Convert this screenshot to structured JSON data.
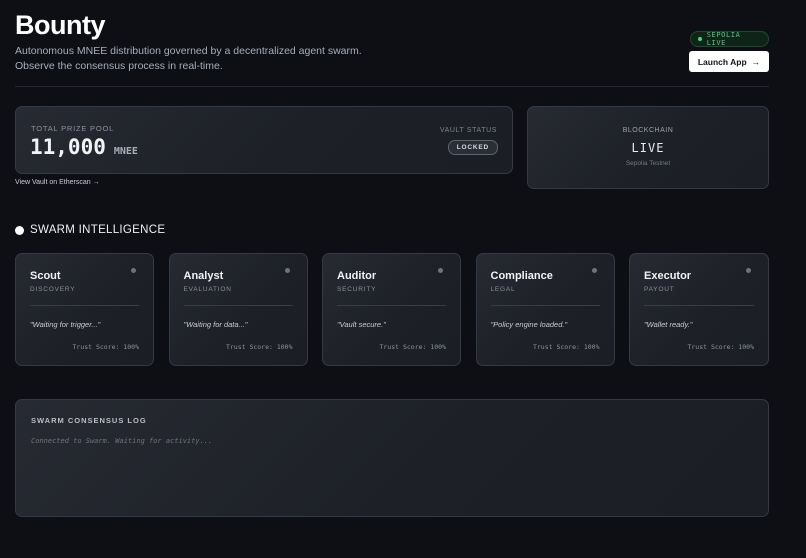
{
  "header": {
    "title": "Bounty",
    "subtitle_line1": "Autonomous MNEE distribution governed by a decentralized agent swarm.",
    "subtitle_line2": "Observe the consensus process in real-time.",
    "network_badge": "SEPOLIA LIVE",
    "launch_button": "Launch App",
    "launch_arrow": "→"
  },
  "prize": {
    "label": "TOTAL PRIZE POOL",
    "amount": "11,000",
    "unit": "MNEE",
    "vault_label": "VAULT STATUS",
    "vault_status": "LOCKED",
    "etherscan_link": "View Vault on Etherscan →"
  },
  "chain": {
    "label": "BLOCKCHAIN",
    "status": "LIVE",
    "network": "Sepolia Testnet"
  },
  "swarm": {
    "heading": "SWARM INTELLIGENCE",
    "agents": [
      {
        "name": "Scout",
        "role": "DISCOVERY",
        "message": "\"Waiting for trigger...\"",
        "trust": "Trust Score: 100%"
      },
      {
        "name": "Analyst",
        "role": "EVALUATION",
        "message": "\"Waiting for data...\"",
        "trust": "Trust Score: 100%"
      },
      {
        "name": "Auditor",
        "role": "SECURITY",
        "message": "\"Vault secure.\"",
        "trust": "Trust Score: 100%"
      },
      {
        "name": "Compliance",
        "role": "LEGAL",
        "message": "\"Policy engine loaded.\"",
        "trust": "Trust Score: 100%"
      },
      {
        "name": "Executor",
        "role": "PAYOUT",
        "message": "\"Wallet ready.\"",
        "trust": "Trust Score: 100%"
      }
    ]
  },
  "log": {
    "title": "SWARM CONSENSUS LOG",
    "line": "Connected to Swarm. Waiting for activity..."
  },
  "colors": {
    "background": "#0d0f15",
    "live_green": "#4ad27a",
    "card_border": "#353944"
  }
}
